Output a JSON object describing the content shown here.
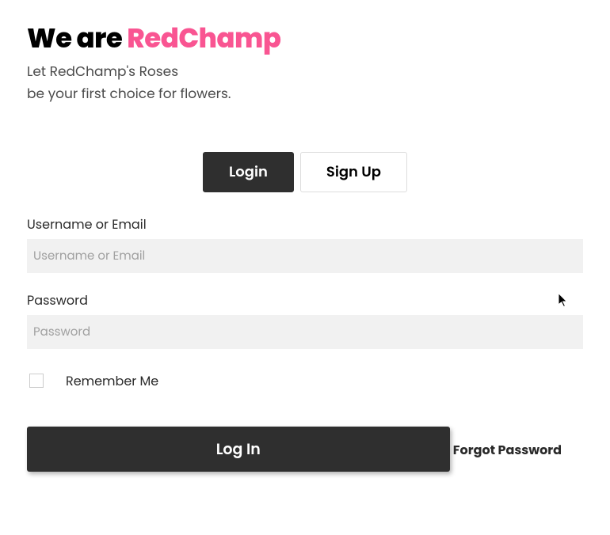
{
  "header": {
    "title_prefix": "We are ",
    "title_brand": "RedChamp",
    "tagline_line1": "Let RedChamp's Roses",
    "tagline_line2": "be your first choice for flowers."
  },
  "tabs": {
    "login": "Login",
    "signup": "Sign Up"
  },
  "form": {
    "username_label": "Username or Email",
    "username_placeholder": "Username or Email",
    "password_label": "Password",
    "password_placeholder": "Password",
    "remember_label": "Remember Me",
    "submit_label": "Log In",
    "forgot_label": "Forgot Password"
  },
  "colors": {
    "brand_pink": "#f95592",
    "dark_button": "#2f2f2f",
    "input_bg": "#f1f1f1"
  }
}
